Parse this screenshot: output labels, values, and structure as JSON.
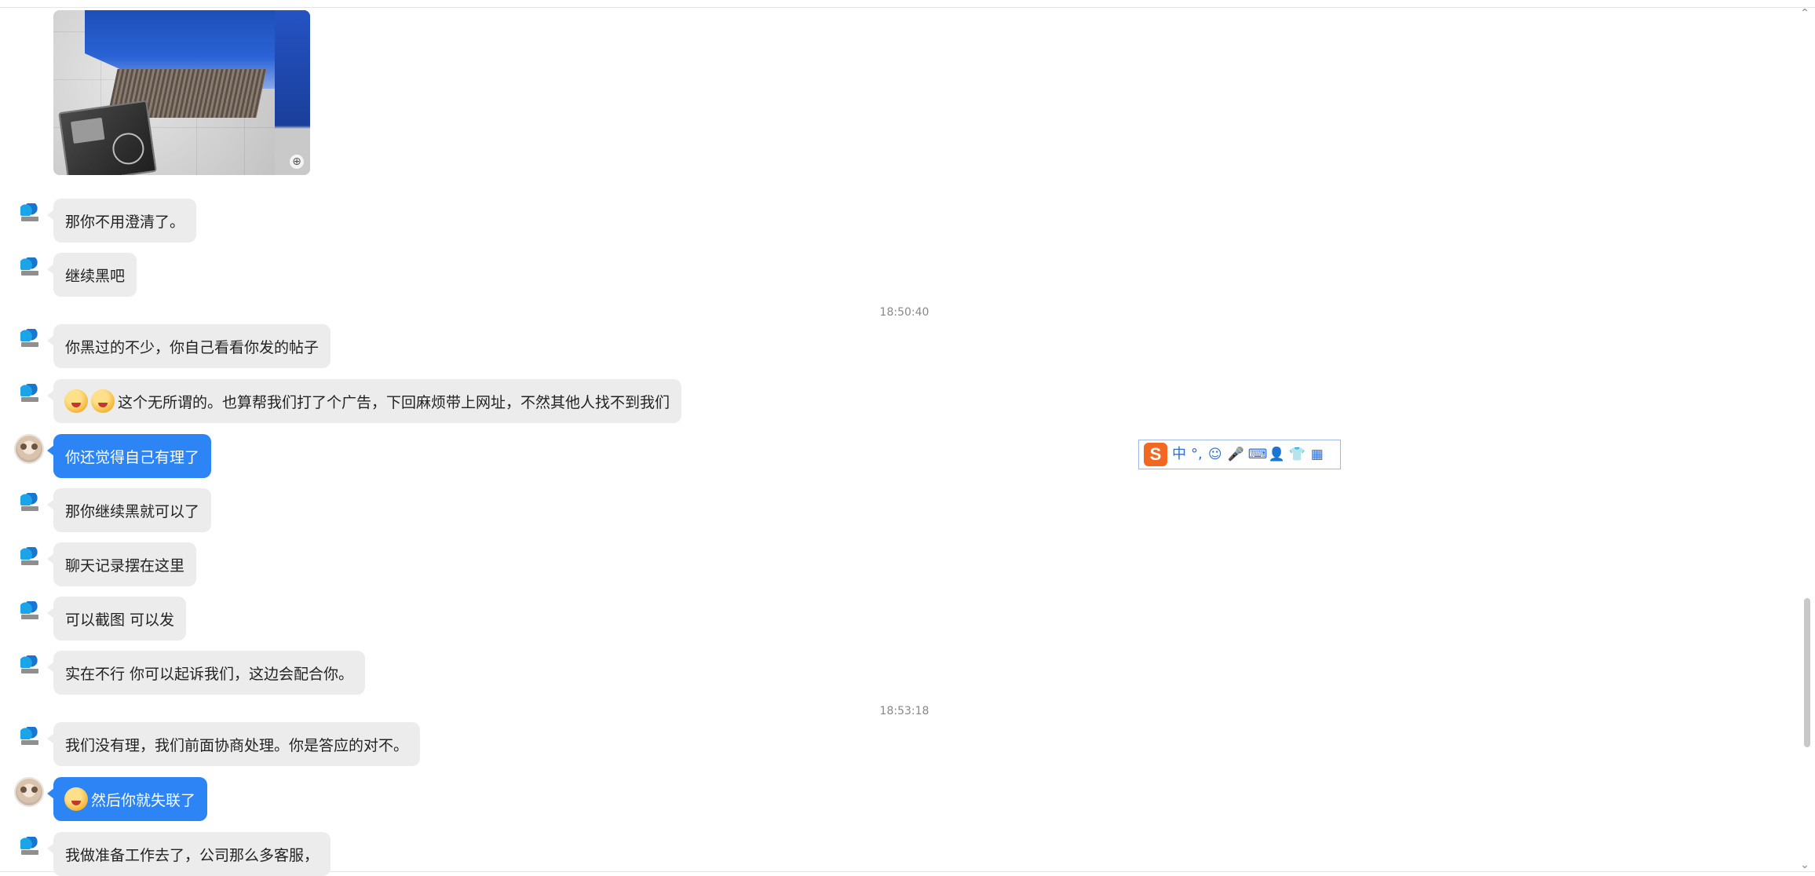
{
  "chat": {
    "time1": "18:50:40",
    "time2": "18:53:18",
    "messages": [
      {
        "side": "in",
        "text": "那你不用澄清了。"
      },
      {
        "side": "in",
        "text": "继续黑吧"
      },
      {
        "side": "in",
        "text": "你黑过的不少，你自己看看你发的帖子"
      },
      {
        "side": "in",
        "text": "这个无所谓的。也算帮我们打了个广告，下回麻烦带上网址，不然其他人找不到我们",
        "emojis": 2
      },
      {
        "side": "out",
        "text": "你还觉得自己有理了"
      },
      {
        "side": "in",
        "text": "那你继续黑就可以了"
      },
      {
        "side": "in",
        "text": "聊天记录摆在这里"
      },
      {
        "side": "in",
        "text": "可以截图  可以发"
      },
      {
        "side": "in",
        "text": "实在不行 你可以起诉我们，这边会配合你。"
      },
      {
        "side": "in",
        "text": "我们没有理，我们前面协商处理。你是答应的对不。"
      },
      {
        "side": "out",
        "text": "然后你就失联了",
        "emojis": 1
      },
      {
        "side": "in",
        "text": "我做准备工作去了，公司那么多客服，"
      }
    ]
  },
  "ime": {
    "logo": "S",
    "mode": "中",
    "punct": "°,",
    "icons": [
      "smile-icon",
      "mic-icon",
      "keyboard-icon",
      "user-setting-icon",
      "shirt-icon",
      "grid-icon"
    ],
    "icon_glyphs": [
      "☺",
      "🎤",
      "⌨",
      "👤",
      "👕",
      "▦"
    ]
  },
  "scroll": {
    "up": "⌃",
    "down": "⌄"
  }
}
